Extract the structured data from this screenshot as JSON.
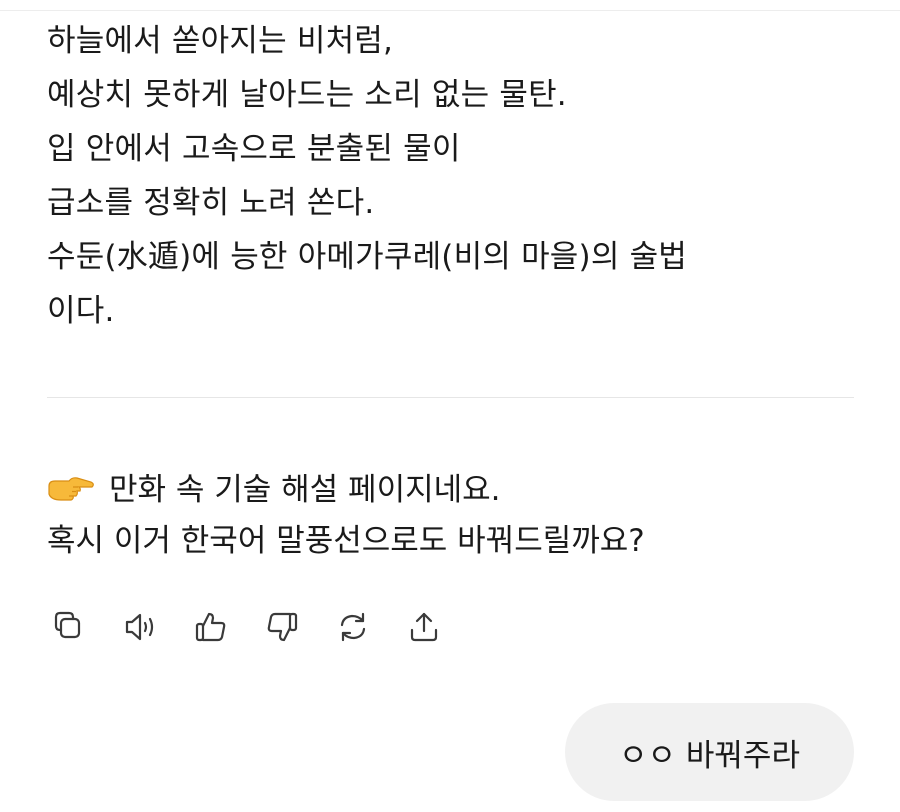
{
  "assistant": {
    "poem_lines": [
      "하늘에서 쏟아지는 비처럼,",
      "예상치 못하게 날아드는 소리 없는 물탄.",
      "입 안에서 고속으로 분출된 물이",
      "급소를 정확히 노려 쏜다.",
      "수둔(水遁)에 능한 아메가쿠레(비의 마을)의 술법",
      "이다."
    ],
    "reply": {
      "emoji_icon": "backhand-index-pointing-right-icon",
      "line1": "만화 속 기술 해설 페이지네요.",
      "line2": "혹시 이거 한국어 말풍선으로도 바꿔드릴까요?"
    },
    "actions": [
      {
        "name": "copy-button",
        "icon": "copy-icon"
      },
      {
        "name": "read-aloud-button",
        "icon": "speaker-icon"
      },
      {
        "name": "thumbs-up-button",
        "icon": "thumbs-up-icon"
      },
      {
        "name": "thumbs-down-button",
        "icon": "thumbs-down-icon"
      },
      {
        "name": "regenerate-button",
        "icon": "regenerate-icon"
      },
      {
        "name": "share-button",
        "icon": "share-icon"
      }
    ]
  },
  "user": {
    "message": "ㅇㅇ 바꿔주라"
  },
  "colors": {
    "icon_stroke": "#3a3a3a",
    "user_bubble_bg": "#f1f1f1",
    "divider": "#e6e6e6"
  }
}
